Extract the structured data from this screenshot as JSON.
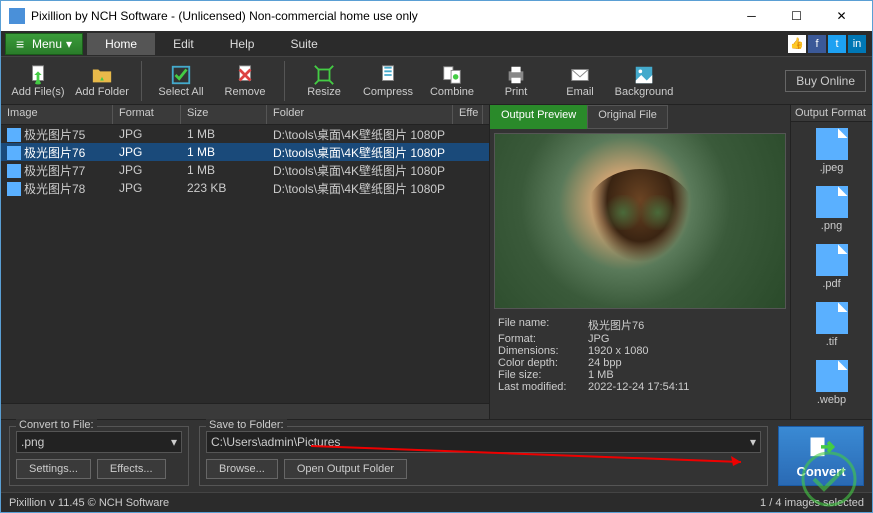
{
  "title": "Pixillion by NCH Software - (Unlicensed) Non-commercial home use only",
  "menubar": {
    "menu": "Menu",
    "tabs": [
      "Home",
      "Edit",
      "Help",
      "Suite"
    ]
  },
  "toolbar": {
    "addfiles": "Add File(s)",
    "addfolder": "Add Folder",
    "selectall": "Select All",
    "remove": "Remove",
    "resize": "Resize",
    "compress": "Compress",
    "combine": "Combine",
    "print": "Print",
    "email": "Email",
    "background": "Background",
    "buy": "Buy Online"
  },
  "headers": {
    "image": "Image",
    "format": "Format",
    "size": "Size",
    "folder": "Folder",
    "effects": "Effe"
  },
  "files": [
    {
      "name": "极光图片75",
      "fmt": "JPG",
      "size": "1 MB",
      "folder": "D:\\tools\\桌面\\4K壁纸图片 1080P"
    },
    {
      "name": "极光图片76",
      "fmt": "JPG",
      "size": "1 MB",
      "folder": "D:\\tools\\桌面\\4K壁纸图片 1080P"
    },
    {
      "name": "极光图片77",
      "fmt": "JPG",
      "size": "1 MB",
      "folder": "D:\\tools\\桌面\\4K壁纸图片 1080P"
    },
    {
      "name": "极光图片78",
      "fmt": "JPG",
      "size": "223 KB",
      "folder": "D:\\tools\\桌面\\4K壁纸图片 1080P"
    }
  ],
  "preview": {
    "tab_output": "Output Preview",
    "tab_original": "Original File",
    "labels": {
      "filename": "File name:",
      "format": "Format:",
      "dimensions": "Dimensions:",
      "colordepth": "Color depth:",
      "filesize": "File size:",
      "lastmod": "Last modified:"
    },
    "values": {
      "filename": "极光图片76",
      "format": "JPG",
      "dimensions": "1920 x 1080",
      "colordepth": "24 bpp",
      "filesize": "1 MB",
      "lastmod": "2022-12-24 17:54:11"
    }
  },
  "formats": {
    "header": "Output Format",
    "items": [
      ".jpeg",
      ".png",
      ".pdf",
      ".tif",
      ".webp"
    ]
  },
  "bottom": {
    "convert_to": "Convert to File:",
    "convert_val": ".png",
    "settings": "Settings...",
    "effects": "Effects...",
    "save_to": "Save to Folder:",
    "save_val": "C:\\Users\\admin\\Pictures",
    "browse": "Browse...",
    "openout": "Open Output Folder",
    "convert": "Convert"
  },
  "status": {
    "left": "Pixillion v 11.45  © NCH Software",
    "right": "1 / 4 images selected"
  }
}
